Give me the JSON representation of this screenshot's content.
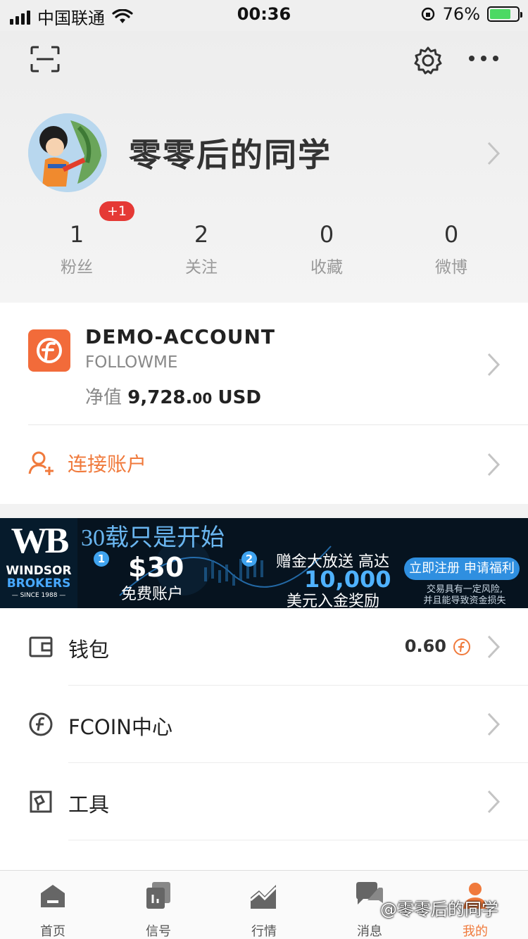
{
  "status_bar": {
    "carrier": "中国联通",
    "time": "00:36",
    "battery_percent": "76%",
    "battery_level": 0.76
  },
  "profile": {
    "username": "零零后的同学",
    "stats": [
      {
        "count": "1",
        "label": "粉丝",
        "badge": "+1"
      },
      {
        "count": "2",
        "label": "关注"
      },
      {
        "count": "0",
        "label": "收藏"
      },
      {
        "count": "0",
        "label": "微博"
      }
    ]
  },
  "account": {
    "name": "DEMO-ACCOUNT",
    "broker": "FOLLOWME",
    "equity_label": "净值",
    "equity_int": "9,728.",
    "equity_dec": "00",
    "equity_currency": "USD",
    "connect_label": "连接账户"
  },
  "banner": {
    "brand_initials": "WB",
    "brand_line1": "WINDSOR",
    "brand_line2": "BROKERS",
    "brand_since": "— SINCE 1988 —",
    "headline": "30载只是开始",
    "step1": "1",
    "step2": "2",
    "amount": "$30",
    "amount_caption": "免费账户",
    "gift": "赠金大放送 高达",
    "gift_amount": "10,000",
    "gift_caption": "美元入金奖励",
    "cta": "立即注册 申请福利",
    "risk_line1": "交易具有一定风险,",
    "risk_line2": "并且能导致资金损失"
  },
  "menu": [
    {
      "label": "钱包",
      "value": "0.60",
      "icon": "wallet-icon"
    },
    {
      "label": "FCOIN中心",
      "icon": "fcoin-icon"
    },
    {
      "label": "工具",
      "icon": "tools-icon"
    }
  ],
  "tabs": [
    {
      "label": "首页",
      "icon": "home-icon"
    },
    {
      "label": "信号",
      "icon": "signal-icon"
    },
    {
      "label": "行情",
      "icon": "market-icon"
    },
    {
      "label": "消息",
      "icon": "message-icon"
    },
    {
      "label": "我的",
      "icon": "profile-icon",
      "active": true
    }
  ],
  "watermark": "@零零后的同学",
  "colors": {
    "accent": "#f07a3c",
    "badge": "#e53935",
    "banner_bg": "#06131f"
  }
}
